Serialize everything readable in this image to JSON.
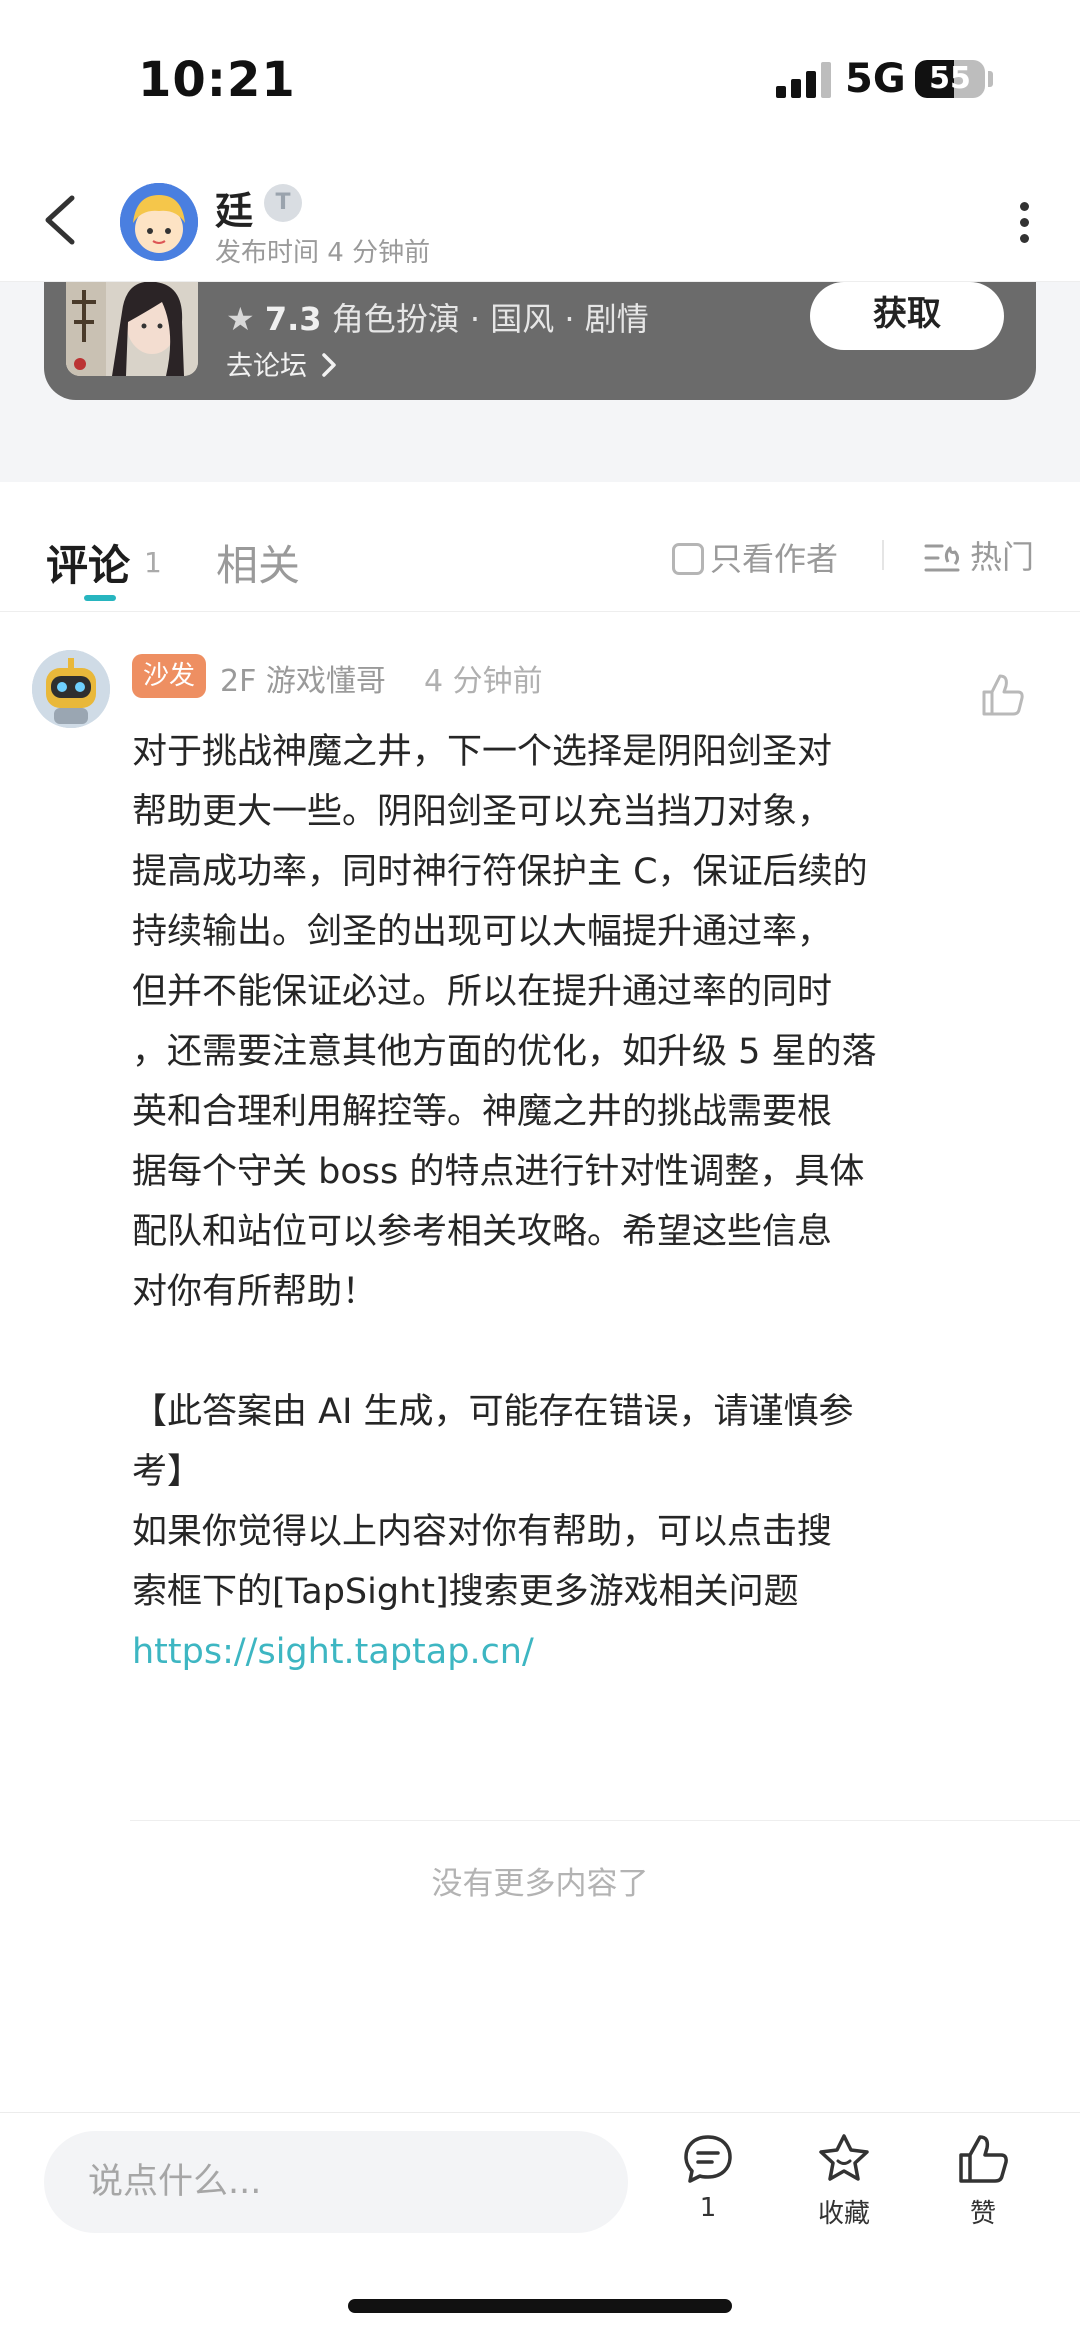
{
  "status_bar": {
    "time": "10:21",
    "network": "5G",
    "battery": "55",
    "battery_level": 0.55
  },
  "header": {
    "author_name": "廷",
    "level_badge": "T",
    "publish_time": "发布时间 4 分钟前"
  },
  "game_card": {
    "rating": "7.3",
    "tags": "角色扮演 · 国风 · 剧情",
    "forum_link": "去论坛",
    "get_button": "获取"
  },
  "tabs": {
    "comments_label": "评论",
    "comments_count": "1",
    "related_label": "相关",
    "author_only_label": "只看作者",
    "sort_label": "热门"
  },
  "comment": {
    "badge": "沙发",
    "floor_user": "2F 游戏懂哥",
    "time": "4 分钟前",
    "lines": [
      "对于挑战神魔之井，下一个选择是阴阳剑圣对",
      "帮助更大一些。阴阳剑圣可以充当挡刀对象，",
      "提高成功率，同时神行符保护主 C，保证后续的",
      "持续输出。剑圣的出现可以大幅提升通过率，",
      "但并不能保证必过。所以在提升通过率的同时",
      "，还需要注意其他方面的优化，如升级 5 星的落",
      "英和合理利用解控等。神魔之井的挑战需要根",
      "据每个守关 boss 的特点进行针对性调整，具体",
      "配队和站位可以参考相关攻略。希望这些信息",
      "对你有所帮助！",
      "",
      "【此答案由 AI 生成，可能存在错误，请谨慎参",
      "考】",
      "如果你觉得以上内容对你有帮助，可以点击搜",
      "索框下的[TapSight]搜索更多游戏相关问题"
    ],
    "link": "https://sight.taptap.cn/"
  },
  "footer": {
    "no_more": "没有更多内容了"
  },
  "bottom_bar": {
    "input_placeholder": "说点什么...",
    "comment_count": "1",
    "favorite_label": "收藏",
    "like_label": "赞"
  },
  "colors": {
    "accent": "#27b5bf",
    "link": "#3db6c2",
    "sofa_badge": "#ee8f62",
    "game_card_bg": "#6b6b6b"
  }
}
